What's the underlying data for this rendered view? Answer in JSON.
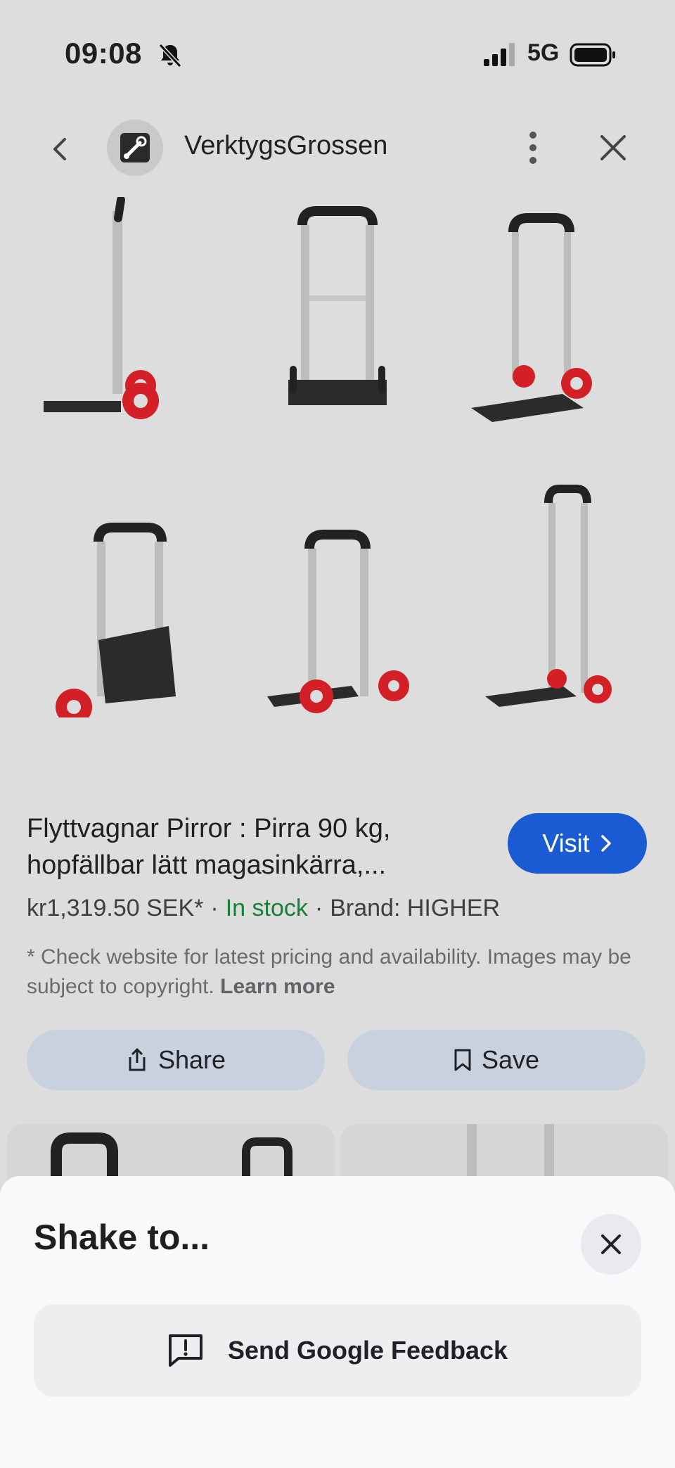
{
  "status_bar": {
    "time": "09:08",
    "network": "5G"
  },
  "header": {
    "site_name": "VerktygsGrossen"
  },
  "product": {
    "title": "Flyttvagnar Pirror : Pirra 90 kg, hopfällbar lätt magasinkärra,...",
    "visit_label": "Visit",
    "price": "kr1,319.50 SEK*",
    "stock": "In stock",
    "brand": "Brand: HIGHER",
    "disclaimer": "* Check website for latest pricing and availability. Images may be subject to copyright.",
    "learn_more": "Learn more"
  },
  "actions": {
    "share_label": "Share",
    "save_label": "Save"
  },
  "sheet": {
    "title": "Shake to...",
    "feedback_label": "Send Google Feedback"
  },
  "colors": {
    "visit_blue": "#1a5bd4",
    "in_stock_green": "#188038",
    "wheel_red": "#d32027"
  }
}
